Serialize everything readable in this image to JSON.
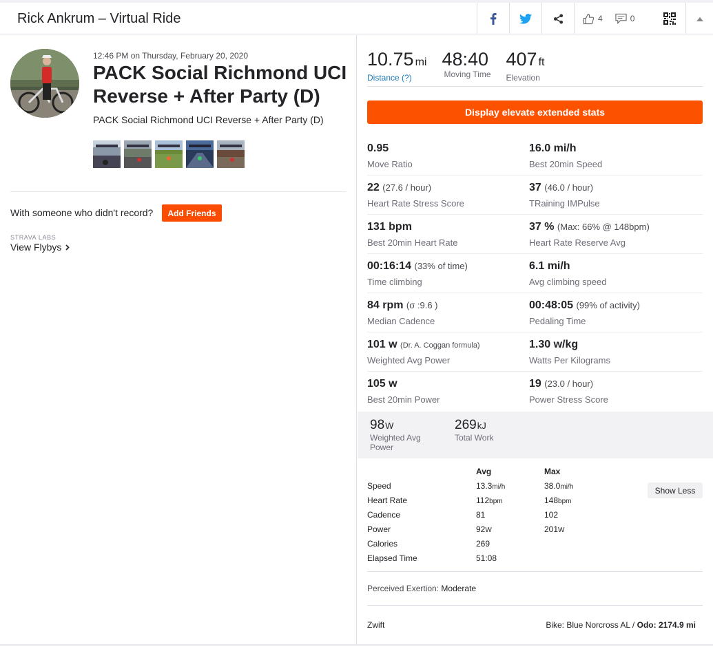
{
  "header": {
    "title": "Rick Ankrum – Virtual Ride",
    "kudos_count": "4",
    "comments_count": "0",
    "icons": [
      "facebook-icon",
      "twitter-icon",
      "share-icon",
      "thumbs-up-icon",
      "comment-icon",
      "qr-code-icon",
      "chevron-up-icon"
    ]
  },
  "activity": {
    "datetime": "12:46 PM on Thursday, February 20, 2020",
    "title": "PACK Social Richmond UCI Reverse + After Party (D)",
    "description": "PACK Social Richmond UCI Reverse + After Party (D)",
    "photo_count": 5
  },
  "social": {
    "with_someone": "With someone who didn't record?",
    "add_friends": "Add Friends",
    "labs_label": "STRAVA LABS",
    "flybys_label": "View Flybys"
  },
  "top_stats": [
    {
      "value": "10.75",
      "unit": "mi",
      "label": "Distance (?)"
    },
    {
      "value": "48:40",
      "unit": "",
      "label": "Moving Time"
    },
    {
      "value": "407",
      "unit": "ft",
      "label": "Elevation"
    }
  ],
  "elevate_button": "Display elevate extended stats",
  "extended_stats": [
    [
      {
        "value": "0.95",
        "sub": "",
        "label": "Move Ratio"
      },
      {
        "value": "16.0 mi/h",
        "sub": "",
        "label": "Best 20min Speed"
      }
    ],
    [
      {
        "value": "22",
        "sub": "(27.6 / hour)",
        "label": "Heart Rate Stress Score"
      },
      {
        "value": "37",
        "sub": "(46.0 / hour)",
        "label": "TRaining IMPulse"
      }
    ],
    [
      {
        "value": "131 bpm",
        "sub": "",
        "label": "Best 20min Heart Rate"
      },
      {
        "value": "37 %",
        "sub": "(Max: 66% @ 148bpm)",
        "label": "Heart Rate Reserve Avg"
      }
    ],
    [
      {
        "value": "00:16:14",
        "sub": "(33% of time)",
        "label": "Time climbing"
      },
      {
        "value": "6.1 mi/h",
        "sub": "",
        "label": "Avg climbing speed"
      }
    ],
    [
      {
        "value": "84 rpm",
        "sub": "(σ :9.6 )",
        "label": "Median Cadence"
      },
      {
        "value": "00:48:05",
        "sub": "(99% of activity)",
        "label": "Pedaling Time"
      }
    ],
    [
      {
        "value": "101 w",
        "tiny": "(Dr. A. Coggan formula)",
        "label": "Weighted Avg Power"
      },
      {
        "value": "1.30 w/kg",
        "sub": "",
        "label": "Watts Per Kilograms"
      }
    ],
    [
      {
        "value": "105 w",
        "sub": "",
        "label": "Best 20min Power"
      },
      {
        "value": "19",
        "sub": "(23.0 / hour)",
        "label": "Power Stress Score"
      }
    ]
  ],
  "power_box": [
    {
      "value": "98",
      "unit": "W",
      "label": "Weighted Avg Power"
    },
    {
      "value": "269",
      "unit": "kJ",
      "label": "Total Work"
    }
  ],
  "more_stats": {
    "avg_header": "Avg",
    "max_header": "Max",
    "show_less": "Show Less",
    "rows": [
      {
        "label": "Speed",
        "avg": "13.3",
        "avg_unit": "mi/h",
        "max": "38.0",
        "max_unit": "mi/h"
      },
      {
        "label": "Heart Rate",
        "avg": "112",
        "avg_unit": "bpm",
        "max": "148",
        "max_unit": "bpm"
      },
      {
        "label": "Cadence",
        "avg": "81",
        "avg_unit": "",
        "max": "102",
        "max_unit": ""
      },
      {
        "label": "Power",
        "avg": "92",
        "avg_unit": "W",
        "max": "201",
        "max_unit": "W"
      },
      {
        "label": "Calories",
        "avg": "269",
        "avg_unit": "",
        "max": "",
        "max_unit": ""
      },
      {
        "label": "Elapsed Time",
        "avg": "51:08",
        "avg_unit": "",
        "max": "",
        "max_unit": ""
      }
    ]
  },
  "exertion": {
    "label": "Perceived Exertion:",
    "value": "Moderate"
  },
  "device": "Zwift",
  "gear": {
    "prefix": "Bike: Blue Norcross AL / ",
    "odo_label": "Odo:",
    "odo_value": "2174.9 mi"
  },
  "colors": {
    "brand_orange": "#fc4c02",
    "link_blue": "#1c7ab9",
    "facebook": "#3b5998",
    "twitter": "#1da1f2"
  }
}
